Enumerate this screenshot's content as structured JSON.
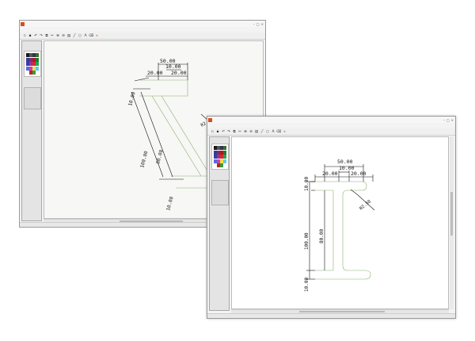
{
  "back_window": {
    "title": "",
    "menu": [
      "",
      "",
      "",
      "",
      ""
    ],
    "toolbar_close_label": "",
    "dimensions": {
      "top_total": "50.00",
      "top_mid": "10.00",
      "top_left": "20.00",
      "top_right": "20.00",
      "left_top": "10.00",
      "left_height": "100.00",
      "left_mid": "80.00",
      "left_bottom": "10.00",
      "radius": "R2.50"
    }
  },
  "front_window": {
    "title": "",
    "menu": [
      "",
      "",
      "",
      "",
      ""
    ],
    "toolbar_close_label": "",
    "dimensions": {
      "top_total": "50.00",
      "top_mid": "10.00",
      "top_left": "20.00",
      "top_right": "20.00",
      "left_top": "10.00",
      "left_height": "100.00",
      "left_mid": "80.00",
      "left_bottom": "10.00",
      "radius": "R2.50"
    }
  },
  "palette": [
    "#1a1a1a",
    "#555555",
    "#2a3a4a",
    "#3a6b2a",
    "#3b3b8f",
    "#7a2d7a",
    "#b01a1a",
    "#1f7a3a",
    "#3a3aa8",
    "#a03090",
    "#d82a2a",
    "#2aa04a",
    "#5a6ad8",
    "#d83ab8",
    "#f0e040",
    "#60c8e8",
    "#ffffff",
    "#c02020",
    "#3a9a3a",
    "#ffffff"
  ],
  "colors": {
    "app_icon": "#d84d1c",
    "drawing_line": "#111111",
    "profile_line": "#8ab070"
  },
  "icons": {
    "toolbar": [
      "new-file-icon",
      "open-icon",
      "undo-icon",
      "redo-icon",
      "copy-icon",
      "cut-icon",
      "zoom-icon",
      "print-icon",
      "line-icon",
      "circle-icon",
      "text-icon",
      "delete-icon"
    ]
  }
}
